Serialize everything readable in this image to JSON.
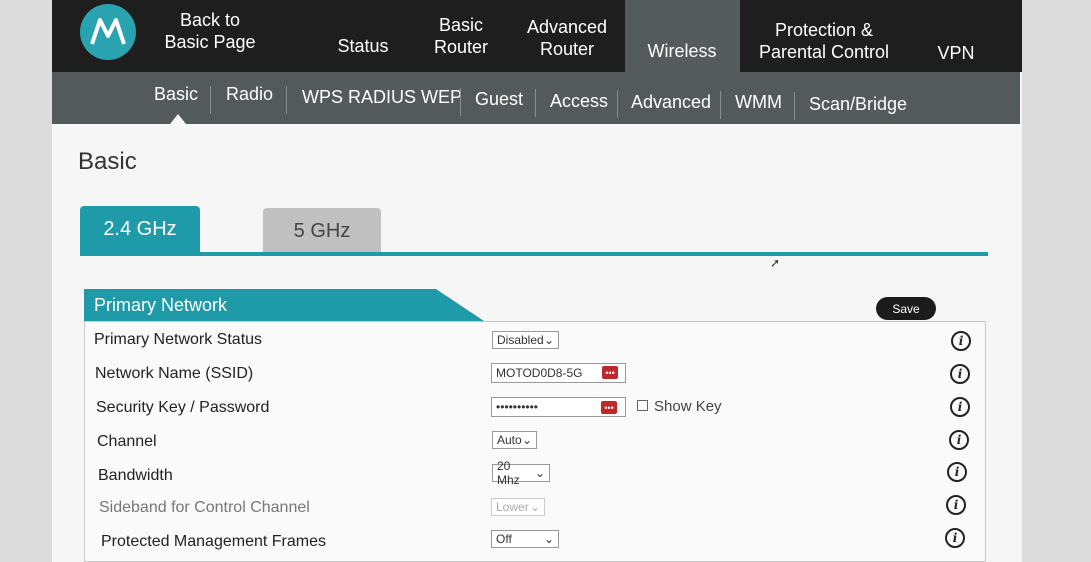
{
  "topnav": {
    "back_line1": "Back to",
    "back_line2": "Basic Page",
    "status": "Status",
    "basic_router_1": "Basic",
    "basic_router_2": "Router",
    "advanced_router_1": "Advanced",
    "advanced_router_2": "Router",
    "wireless": "Wireless",
    "protection_1": "Protection &",
    "protection_2": "Parental Control",
    "vpn": "VPN"
  },
  "subnav": {
    "items": [
      "Basic",
      "Radio",
      "WPS RADIUS WEP",
      "Guest",
      "Access",
      "Advanced",
      "WMM",
      "Scan/Bridge"
    ]
  },
  "page_title": "Basic",
  "tabs": [
    "2.4 GHz",
    "5 GHz"
  ],
  "section_title": "Primary Network",
  "save_label": "Save",
  "rows": [
    {
      "label": "Primary Network Status",
      "value": "Disabled"
    },
    {
      "label": "Network Name (SSID)",
      "value": "MOTOD0D8-5G"
    },
    {
      "label": "Security Key / Password",
      "value": "••••••••••",
      "extra": "Show Key"
    },
    {
      "label": "Channel",
      "value": "Auto"
    },
    {
      "label": "Bandwidth",
      "value": "20 Mhz"
    },
    {
      "label": "Sideband for Control Channel",
      "value": "Lower"
    },
    {
      "label": "Protected Management Frames",
      "value": "Off"
    }
  ],
  "icons": {
    "info": "i",
    "dropdown": "chevron-down-icon",
    "key": "•••"
  },
  "colors": {
    "accent": "#1f9aa8",
    "nav": "#1e1e1e",
    "subnav": "#54595b",
    "badge": "#c0272d"
  }
}
